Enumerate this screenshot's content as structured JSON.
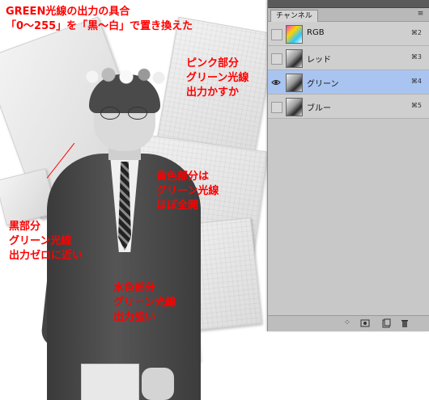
{
  "annotations": {
    "header_line1": "GREEN光線の出力の具合",
    "header_line2": "「0～255」を「黒～白」で置き換えた",
    "pink": [
      "ピンク部分",
      "グリーン光線",
      "出力かすか"
    ],
    "yellow": [
      "黄色部分は",
      "グリーン光線",
      "ほぼ全開"
    ],
    "black": [
      "黒部分",
      "グリーン光線",
      "出力ゼロに近い"
    ],
    "cyan": [
      "水色部分",
      "グリーン光線",
      "出力強い"
    ]
  },
  "panel": {
    "tab_label": "チャンネル",
    "menu_icon": "panel-menu-icon",
    "channels": [
      {
        "name": "RGB",
        "shortcut": "⌘2",
        "visible": false,
        "selected": false,
        "thumb": "color"
      },
      {
        "name": "レッド",
        "shortcut": "⌘3",
        "visible": false,
        "selected": false,
        "thumb": "gray"
      },
      {
        "name": "グリーン",
        "shortcut": "⌘4",
        "visible": true,
        "selected": true,
        "thumb": "gray"
      },
      {
        "name": "ブルー",
        "shortcut": "⌘5",
        "visible": false,
        "selected": false,
        "thumb": "gray"
      }
    ],
    "bottom_icons": [
      "load-selection-icon",
      "save-selection-icon",
      "new-channel-icon",
      "delete-channel-icon"
    ]
  },
  "colors": {
    "annotation": "#ff0000",
    "selected_row": "#a9c4f0",
    "panel_bg": "#c8c8c8"
  }
}
